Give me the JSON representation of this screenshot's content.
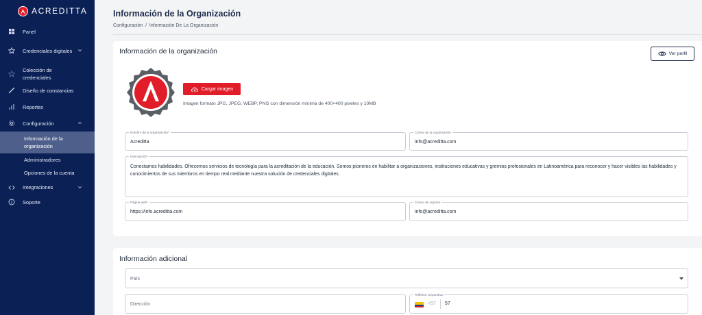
{
  "brand": {
    "name": "ACREDITTA",
    "accent": "#e11d2a",
    "sidebar_bg": "#0b2156"
  },
  "sidebar": {
    "items": [
      {
        "icon": "grid-icon",
        "label": "Panel"
      },
      {
        "icon": "star-icon",
        "label": "Credenciales digitales",
        "expandable": true
      },
      {
        "icon": "star-outline-icon",
        "label": "Colección de credenciales"
      },
      {
        "icon": "brush-icon",
        "label": "Diseño de constancias"
      },
      {
        "icon": "bar-chart-icon",
        "label": "Reportes"
      },
      {
        "icon": "gear-icon",
        "label": "Configuración",
        "expanded": true
      }
    ],
    "sub_items": [
      {
        "label": "Información de la organización",
        "active": true
      },
      {
        "label": "Administradores"
      },
      {
        "label": "Opciones de la cuenta"
      }
    ],
    "bottom_items": [
      {
        "icon": "code-icon",
        "label": "Integraciones",
        "expandable": true
      },
      {
        "icon": "info-icon",
        "label": "Soporte"
      }
    ]
  },
  "header": {
    "title": "Información de la Organización",
    "breadcrumb": "Configuración  /  Información De La Organización"
  },
  "org_card": {
    "title": "Información de la organización",
    "view_profile_label": "Ver perfil",
    "upload_label": "Cargar imagen",
    "image_hint": "Imagen formato JPG, JPEG, WEBP, PNG con dimensión mínima de 400×400 pixeles y 10MB",
    "fields": {
      "org_name": {
        "label": "Nombre de la organización*",
        "value": "Acreditta"
      },
      "org_email": {
        "label": "Correo de la organización",
        "value": "info@acreditta.com"
      },
      "description": {
        "label": "Descripción*",
        "value": "Conectamos habilidades. Ofrecemos servicios de tecnología para la acreditación de la educación. Somos pioneros en habilitar a organizaciones, instituciones educativas y gremios profesionales en Latinoamérica para reconocer y hacer visibles las habilidades y conocimientos de sus miembros en tiempo real mediante nuestra solución de credenciales digitales."
      },
      "website": {
        "label": "Página web*",
        "value": "https://info.acreditta.com"
      },
      "support_email": {
        "label": "Correo de soporte",
        "value": "info@acreditta.com"
      }
    }
  },
  "extra_card": {
    "title": "Información adicional",
    "country_placeholder": "País",
    "address_placeholder": "Dirección",
    "phone": {
      "label": "Teléfono corporativo",
      "dial_code": "+57",
      "value": "57"
    }
  }
}
